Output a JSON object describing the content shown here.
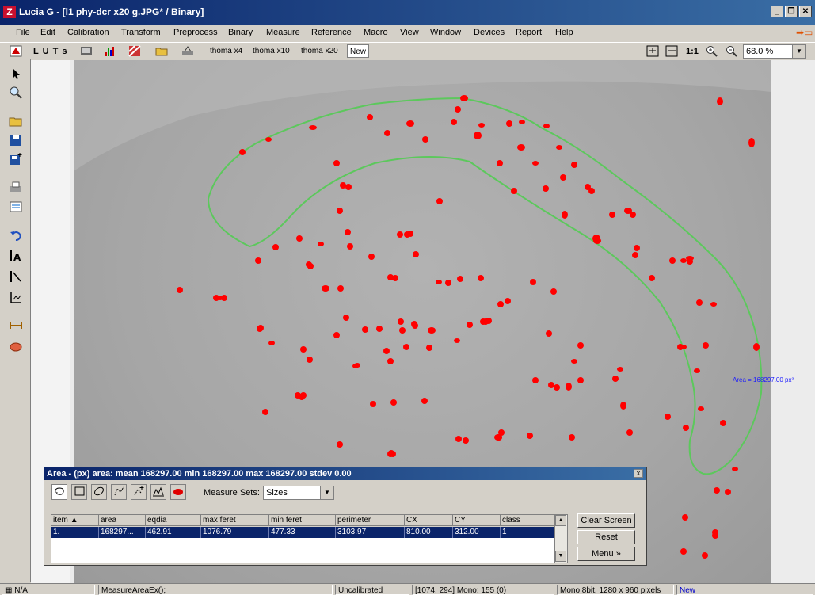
{
  "window": {
    "title": "Lucia G - [l1 phy-dcr x20 g.JPG* / Binary]",
    "icon_letter": "Z",
    "min_label": "_",
    "max_label": "❐",
    "close_label": "✕"
  },
  "menu": [
    "File",
    "Edit",
    "Calibration",
    "Transform",
    "Preprocess",
    "Binary",
    "Measure",
    "Reference",
    "Macro",
    "View",
    "Window",
    "Devices",
    "Report",
    "Help"
  ],
  "toolbar": {
    "luts_label": "L U T s",
    "tabs": [
      "thoma x4",
      "thoma x10",
      "thoma x20",
      "New"
    ],
    "active_tab": "New",
    "one_to_one": "1:1",
    "zoom_value": "68.0 %"
  },
  "image": {
    "area_annotation": "Area = 168297.00 px²"
  },
  "panel": {
    "title": "Area -  (px)   area: mean 168297.00  min 168297.00  max 168297.00  stdev 0.00",
    "close_label": "x",
    "measure_sets_label": "Measure Sets:",
    "measure_sets_value": "Sizes",
    "columns": [
      "item",
      "area",
      "eqdia",
      "max feret",
      "min feret",
      "perimeter",
      "CX",
      "CY",
      "class"
    ],
    "rows": [
      [
        "1.",
        "168297...",
        "462.91",
        "1076.79",
        "477.33",
        "3103.97",
        "810.00",
        "312.00",
        "1"
      ]
    ],
    "buttons": {
      "clear_screen": "Clear Screen",
      "reset": "Reset",
      "menu": "Menu  »"
    }
  },
  "status": {
    "na": "N/A",
    "command": "MeasureAreaEx();",
    "calibration": "Uncalibrated",
    "cursor": "[1074, 294] Mono: 155  (0)",
    "image_info": "Mono 8bit, 1280 x 960 pixels",
    "state": "New"
  },
  "colors": {
    "titlebar": "#0a246a",
    "cells": "#ff0000",
    "roi_outline": "#5cc85c",
    "selection": "#0a246a"
  }
}
